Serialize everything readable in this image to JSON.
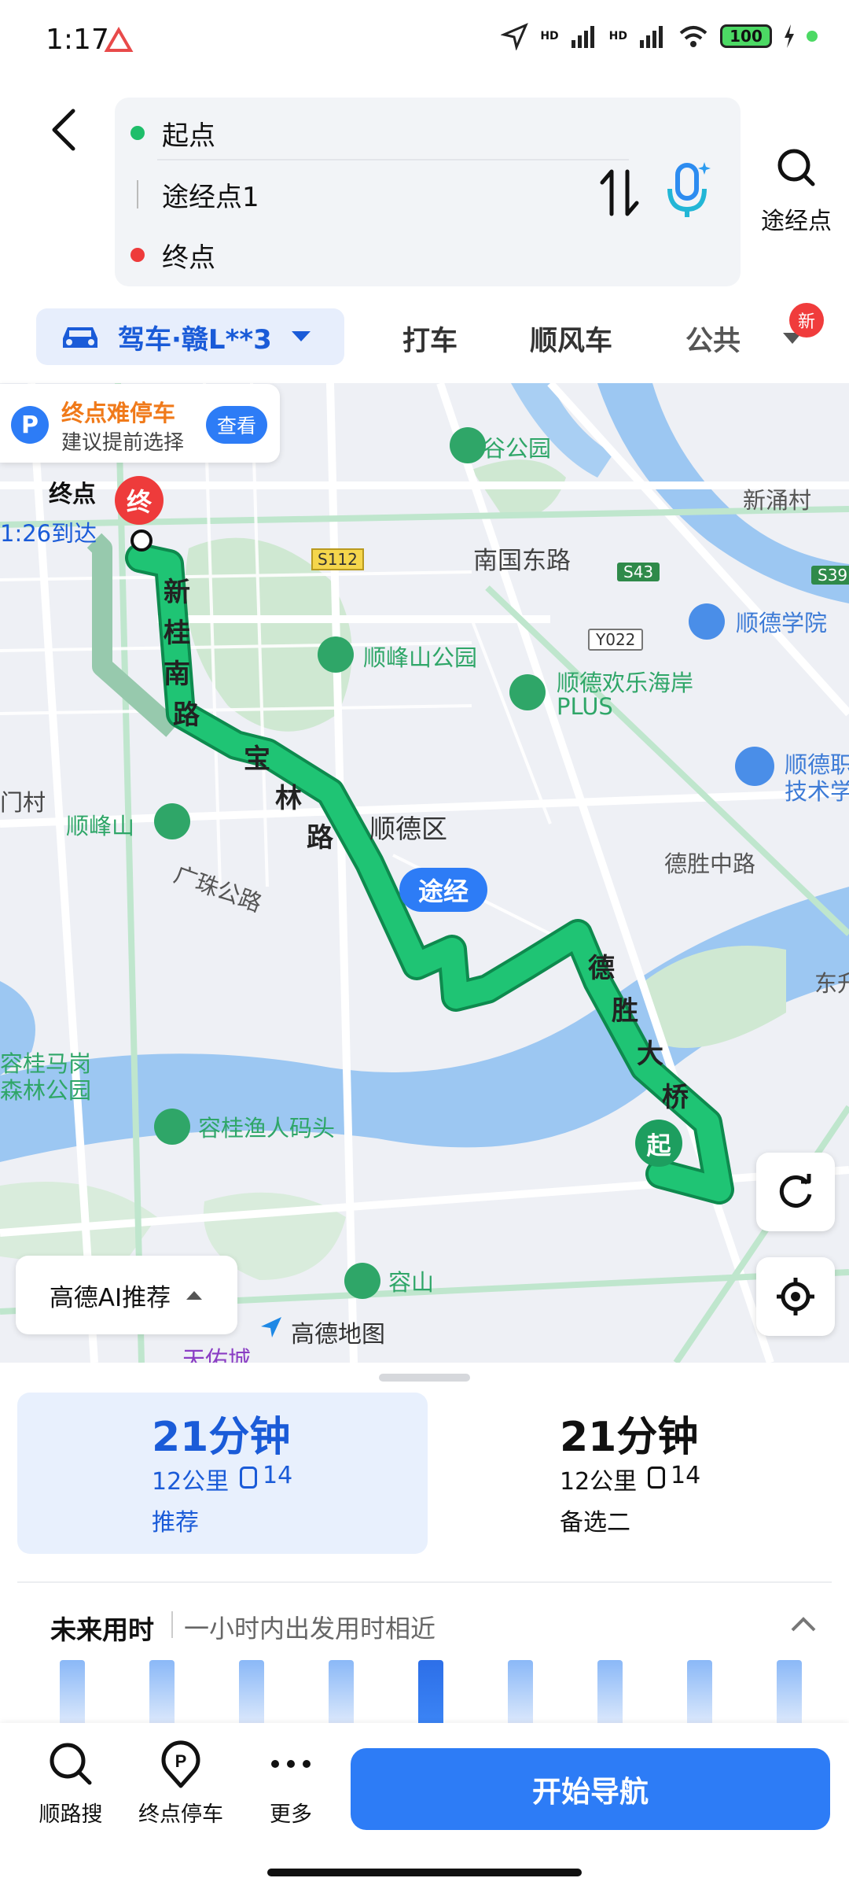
{
  "status_bar": {
    "time": "1:17",
    "battery": "100",
    "signal1": "HD",
    "signal2": "HD"
  },
  "route_inputs": {
    "start": "起点",
    "waypoint": "途经点1",
    "end": "终点"
  },
  "header": {
    "via_label": "途经点"
  },
  "tabs": {
    "mode": "驾车·赣L**3",
    "items": [
      "打车",
      "顺风车",
      "公共"
    ],
    "new_badge": "新"
  },
  "map": {
    "parking_card": {
      "title": "终点难停车",
      "subtitle": "建议提前选择",
      "button": "查看"
    },
    "end_label": "终点",
    "arrive_time": "1:26到达",
    "end_pin": "终",
    "start_pin": "起",
    "via_pin": "途经",
    "labels": {
      "zhigu": "智谷公园",
      "xinyong": "新涌村",
      "nanguo": "南国东路",
      "s112": "S112",
      "s43": "S43",
      "s39": "S39",
      "y022": "Y022",
      "shunde_college": "顺德学院",
      "shunfeng_park": "顺峰山公园",
      "huanle": "顺德欢乐海岸",
      "plus": "PLUS",
      "shunde_tech": "顺德职",
      "tech2": "技术学",
      "menchun": "门村",
      "shunfengshan": "顺峰山",
      "shunde_district": "顺德区",
      "guangzhu": "广珠公路",
      "desheng_road": "德胜中路",
      "donge": "东升",
      "ronggui_forest1": "容桂马岗",
      "ronggui_forest2": "森林公园",
      "yuren": "容桂渔人码头",
      "rongshan": "容山",
      "tianyou": "天佑城",
      "gaode_logo": "高德地图"
    },
    "road_xingui": [
      "新",
      "桂",
      "南",
      "路"
    ],
    "road_baolin": [
      "宝",
      "林",
      "路"
    ],
    "road_desheng": [
      "德",
      "胜",
      "大",
      "桥"
    ],
    "ai_chip": "高德AI推荐"
  },
  "routes": [
    {
      "time": "21分钟",
      "distance": "12公里",
      "lights": "14",
      "tag": "推荐"
    },
    {
      "time": "21分钟",
      "distance": "12公里",
      "lights": "14",
      "tag": "备选二"
    }
  ],
  "future": {
    "title": "未来用时",
    "subtitle": "一小时内出发用时相近"
  },
  "bottom_actions": {
    "search": "顺路搜",
    "parking": "终点停车",
    "more": "更多",
    "start_nav": "开始导航"
  },
  "colors": {
    "accent": "#2d7cf6",
    "route_green": "#1fb870",
    "start_green": "#2fa668",
    "end_red": "#e83e3e"
  }
}
